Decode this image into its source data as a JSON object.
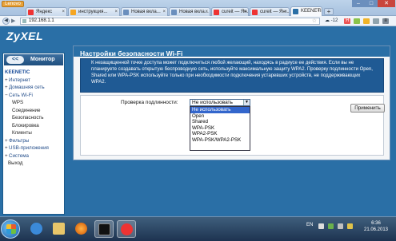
{
  "browser": {
    "app_button": "Lenovo",
    "tabs": [
      {
        "label": "Яндекс",
        "color": "#e33"
      },
      {
        "label": "инструкция...",
        "color": "#f5a623"
      },
      {
        "label": "Новая вкла...",
        "color": "#6b8fbd"
      },
      {
        "label": "Новая вкла...",
        "color": "#6b8fbd"
      },
      {
        "label": "cureit — Ян...",
        "color": "#e33"
      },
      {
        "label": "cureit — Ян...",
        "color": "#e33"
      },
      {
        "label": "KEENETIC",
        "color": "#2a6fa6"
      }
    ],
    "newtab_label": "+",
    "window": {
      "min": "–",
      "max": "□",
      "close": "✕"
    },
    "nav_back": "◀",
    "nav_fwd": "▶",
    "url": "192.168.1.1",
    "weather": "-12",
    "weather_icon": "cloud-icon"
  },
  "router": {
    "logo": "ZyXEL",
    "monitor_label": "Монитор",
    "monitor_icon": "<<",
    "nav": [
      {
        "label": "KEENETIC",
        "kind": "section"
      },
      {
        "label": "Интернет",
        "kind": "top",
        "plus": "+"
      },
      {
        "label": "Домашняя сеть",
        "kind": "top",
        "plus": "+"
      },
      {
        "label": "Сеть Wi-Fi",
        "kind": "top",
        "plus": "−"
      },
      {
        "label": "WPS",
        "kind": "sub"
      },
      {
        "label": "Соединение",
        "kind": "sub"
      },
      {
        "label": "Безопасность",
        "kind": "sub"
      },
      {
        "label": "Блокировка",
        "kind": "sub"
      },
      {
        "label": "Клиенты",
        "kind": "sub"
      },
      {
        "label": "Фильтры",
        "kind": "top",
        "plus": "+"
      },
      {
        "label": "USB-приложения",
        "kind": "top",
        "plus": "+"
      },
      {
        "label": "Система",
        "kind": "top",
        "plus": "+"
      },
      {
        "label": "Выход",
        "kind": "exit"
      }
    ],
    "panel_title": "Настройки безопасности Wi-Fi",
    "info_text": "К незащищенной точке доступа может подключиться любой желающий, находясь в радиусе ее действия. Если вы не планируете создавать открытую беспроводную сеть, используйте максимальную защиту WPA2. Проверку подлинности Open, Shared или WPA-PSK используйте только при необходимости подключения устаревших устройств, не поддерживающих WPA2.",
    "auth_label": "Проверка подлинности:",
    "auth_value": "Не использовать",
    "auth_options": [
      "Не использовать",
      "Open",
      "Shared",
      "WPA-PSK",
      "WPA2-PSK",
      "WPA-PSK/WPA2-PSK"
    ],
    "apply_label": "Применить"
  },
  "taskbar": {
    "lang": "EN",
    "time": "6:36",
    "date": "21.06.2013"
  }
}
